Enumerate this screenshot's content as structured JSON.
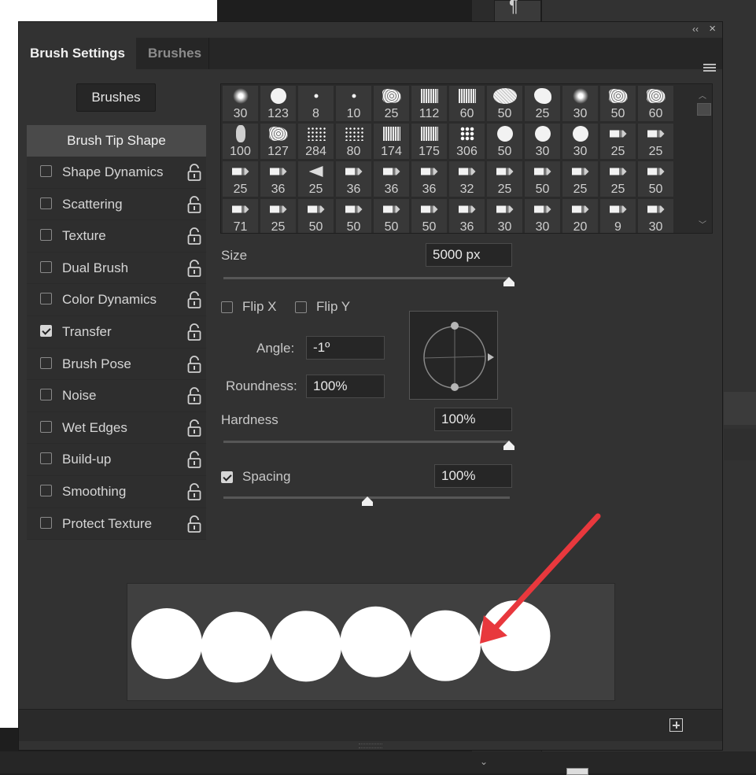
{
  "panel": {
    "tabs": [
      "Brush Settings",
      "Brushes"
    ],
    "brushes_button": "Brushes",
    "options_header": "Brush Tip Shape",
    "options": [
      {
        "label": "Shape Dynamics",
        "checked": false
      },
      {
        "label": "Scattering",
        "checked": false
      },
      {
        "label": "Texture",
        "checked": false
      },
      {
        "label": "Dual Brush",
        "checked": false
      },
      {
        "label": "Color Dynamics",
        "checked": false
      },
      {
        "label": "Transfer",
        "checked": true
      },
      {
        "label": "Brush Pose",
        "checked": false
      },
      {
        "label": "Noise",
        "checked": false
      },
      {
        "label": "Wet Edges",
        "checked": false
      },
      {
        "label": "Build-up",
        "checked": false
      },
      {
        "label": "Smoothing",
        "checked": false
      },
      {
        "label": "Protect Texture",
        "checked": false
      }
    ]
  },
  "brush_grid": {
    "rows": [
      [
        "30",
        "123",
        "8",
        "10",
        "25",
        "112",
        "60",
        "50",
        "25",
        "30",
        "50",
        "60"
      ],
      [
        "100",
        "127",
        "284",
        "80",
        "174",
        "175",
        "306",
        "50",
        "30",
        "30",
        "25",
        "25"
      ],
      [
        "25",
        "36",
        "25",
        "36",
        "36",
        "36",
        "32",
        "25",
        "50",
        "25",
        "25",
        "50"
      ],
      [
        "71",
        "25",
        "50",
        "50",
        "50",
        "50",
        "36",
        "30",
        "30",
        "20",
        "9",
        "30"
      ]
    ]
  },
  "tip_shape": {
    "size_label": "Size",
    "size_value": "5000 px",
    "size_level": 1.0,
    "flip_x_label": "Flip X",
    "flip_y_label": "Flip Y",
    "angle_label": "Angle:",
    "angle_value": "-1º",
    "roundness_label": "Roundness:",
    "roundness_value": "100%",
    "hardness_label": "Hardness",
    "hardness_value": "100%",
    "hardness_level": 1.0,
    "spacing_label": "Spacing",
    "spacing_value": "100%",
    "spacing_checked": true,
    "spacing_level": 0.5
  },
  "preview": {
    "circle_count": 6,
    "arrow_color": "#e8383d"
  },
  "colors": {
    "panel_bg": "#323232",
    "accent_arrow": "#e8383d"
  }
}
